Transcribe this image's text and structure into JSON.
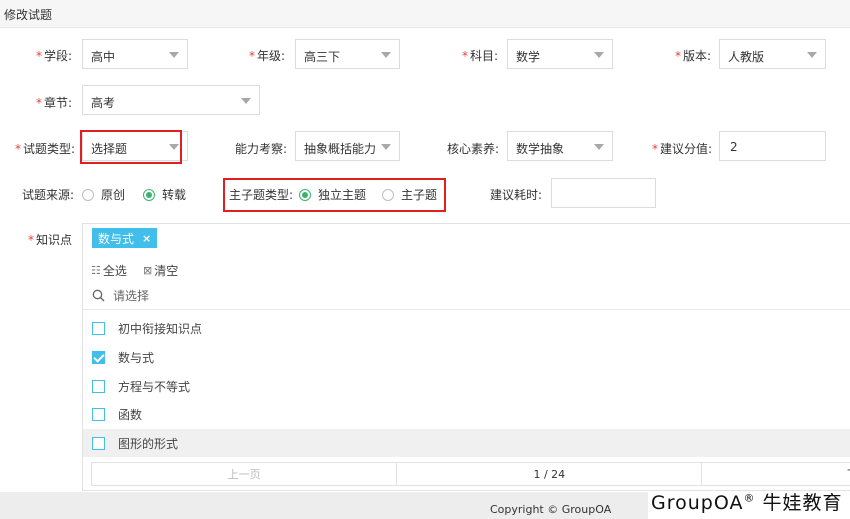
{
  "page": {
    "title": "修改试题"
  },
  "form": {
    "xueduan": {
      "label": "学段:",
      "value": "高中"
    },
    "nianji": {
      "label": "年级:",
      "value": "高三下"
    },
    "kemu": {
      "label": "科目:",
      "value": "数学"
    },
    "banben": {
      "label": "版本:",
      "value": "人教版"
    },
    "zhangjie": {
      "label": "章节:",
      "value": "高考"
    },
    "shiti_leixing": {
      "label": "试题类型:",
      "value": "选择题"
    },
    "nengli_kaocha": {
      "label": "能力考察:",
      "value": "抽象概括能力"
    },
    "hexin_suyang": {
      "label": "核心素养:",
      "value": "数学抽象"
    },
    "jianyi_fenzhi": {
      "label": "建议分值:",
      "value": "2"
    },
    "shiti_laiyuan": {
      "label": "试题来源:",
      "options": [
        "原创",
        "转载"
      ],
      "selected": "转载"
    },
    "zhuziti_leixing": {
      "label": "主子题类型:",
      "options": [
        "独立主题",
        "主子题"
      ],
      "selected": "独立主题"
    },
    "jianyi_haoshi": {
      "label": "建议耗时:",
      "value": ""
    },
    "zhishidian": {
      "label": "知识点",
      "selected_tags": [
        "数与式"
      ],
      "tag_close": "×",
      "select_all": "全选",
      "clear": "清空",
      "search_placeholder": "请选择",
      "items": [
        {
          "label": "初中衔接知识点",
          "checked": false
        },
        {
          "label": "数与式",
          "checked": true
        },
        {
          "label": "方程与不等式",
          "checked": false
        },
        {
          "label": "函数",
          "checked": false
        },
        {
          "label": "图形的形式",
          "checked": false
        }
      ],
      "pager": {
        "prev": "上一页",
        "page": "1 / 24",
        "next": "下"
      }
    }
  },
  "footer": {
    "copyright": "Copyright © GroupOA"
  },
  "watermark": {
    "brand": "GroupOA",
    "reg": "®",
    "text": "牛娃教育"
  },
  "colors": {
    "accent": "#41bfea",
    "radio_on": "#3db26f",
    "required": "#e8403a",
    "highlight_box": "#e02020"
  }
}
